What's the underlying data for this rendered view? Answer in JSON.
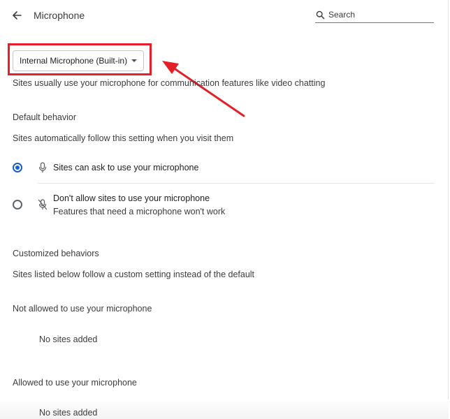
{
  "header": {
    "title": "Microphone",
    "search_placeholder": "Search",
    "search_value": ""
  },
  "device_select": {
    "selected": "Internal Microphone (Built-in)"
  },
  "intro_text": "Sites usually use your microphone for communication features like video chatting",
  "default_behavior": {
    "heading": "Default behavior",
    "description": "Sites automatically follow this setting when you visit them",
    "options": [
      {
        "label": "Sites can ask to use your microphone",
        "sublabel": "",
        "checked": true,
        "icon": "microphone-icon"
      },
      {
        "label": "Don't allow sites to use your microphone",
        "sublabel": "Features that need a microphone won't work",
        "checked": false,
        "icon": "microphone-off-icon"
      }
    ]
  },
  "customized": {
    "heading": "Customized behaviors",
    "description": "Sites listed below follow a custom setting instead of the default",
    "not_allowed": {
      "label": "Not allowed to use your microphone",
      "empty_text": "No sites added"
    },
    "allowed": {
      "label": "Allowed to use your microphone",
      "empty_text": "No sites added"
    }
  },
  "colors": {
    "annotation_red": "#e3202a",
    "radio_blue": "#1a5fc7"
  }
}
